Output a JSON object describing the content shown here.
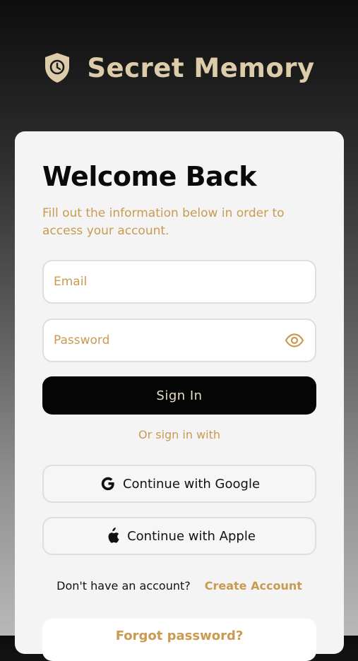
{
  "header": {
    "brand_name": "Secret Memory",
    "logo_icon": "shield-clock-icon",
    "brand_color": "#dcccaa"
  },
  "login": {
    "title": "Welcome Back",
    "subtitle": "Fill out the information below in order to access your account.",
    "email_placeholder": "Email",
    "password_placeholder": "Password",
    "sign_in_label": "Sign In",
    "or_text": "Or sign in with",
    "google_label": "Continue with Google",
    "apple_label": "Continue with Apple",
    "signup_prompt": "Don't have an account?",
    "create_account_label": "Create Account",
    "forgot_password_label": "Forgot password?"
  },
  "colors": {
    "accent": "#c99a50",
    "button_bg": "#050505",
    "card_bg": "#f4f4f4"
  }
}
